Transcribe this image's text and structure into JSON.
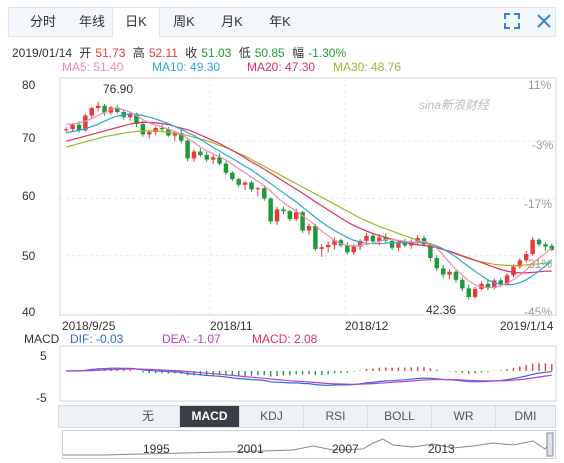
{
  "tabs": [
    "分时",
    "年线",
    "日K",
    "周K",
    "月K",
    "年K"
  ],
  "active_tab": "日K",
  "quote": {
    "date": "2019/01/14",
    "open_label": "开",
    "open": "51.73",
    "high_label": "高",
    "high": "52.11",
    "close_label": "收",
    "close": "51.03",
    "low_label": "低",
    "low": "50.85",
    "change_label": "幅",
    "change": "-1.30%"
  },
  "ma": [
    {
      "label": "MA5: 51.40",
      "color": "#f08ab0"
    },
    {
      "label": "MA10: 49.30",
      "color": "#2aa6d8"
    },
    {
      "label": "MA20: 47.30",
      "color": "#e0305a"
    },
    {
      "label": "MA30: 48.76",
      "color": "#9cb82a"
    }
  ],
  "y_ticks": [
    "80",
    "70",
    "60",
    "50",
    "40"
  ],
  "pct_ticks": [
    "11%",
    "-3%",
    "-17%",
    "-31%",
    "-45%"
  ],
  "x_labels": [
    "2018/9/25",
    "2018/11",
    "2018/12",
    "2019/1/14"
  ],
  "annotations": {
    "high": "76.90",
    "low": "42.36"
  },
  "watermark": "sina新浪财经",
  "macd": {
    "title": "MACD",
    "dif": "DIF: -0.03",
    "dea": "DEA: -1.07",
    "macd": "MACD: 2.08",
    "y_ticks": [
      "5",
      "-5"
    ]
  },
  "indicators": [
    "无",
    "MACD",
    "KDJ",
    "RSI",
    "BOLL",
    "WR",
    "DMI"
  ],
  "active_indicator": "MACD",
  "overview_years": [
    "1995",
    "2001",
    "2007",
    "2013"
  ],
  "colors": {
    "up": "#e63b3b",
    "down": "#1f9a3a",
    "accent": "#2b6fd6"
  },
  "icons": [
    "expand-icon",
    "close-icon",
    "arrow-up-icon",
    "arrow-down-icon"
  ],
  "chart_data": {
    "type": "candlestick",
    "ylim": [
      40,
      80
    ],
    "candles": [
      [
        72.0,
        72.5,
        71.6,
        72.1
      ],
      [
        72.1,
        73.2,
        71.8,
        72.9
      ],
      [
        72.9,
        73.5,
        71.5,
        71.9
      ],
      [
        71.9,
        74.8,
        71.7,
        74.5
      ],
      [
        74.5,
        76.0,
        74.0,
        75.8
      ],
      [
        75.8,
        76.9,
        75.2,
        76.2
      ],
      [
        76.2,
        76.5,
        74.5,
        75.0
      ],
      [
        75.0,
        76.2,
        74.6,
        75.9
      ],
      [
        75.9,
        76.3,
        74.8,
        75.1
      ],
      [
        75.1,
        75.6,
        73.8,
        74.2
      ],
      [
        74.2,
        75.2,
        73.6,
        74.8
      ],
      [
        74.8,
        75.0,
        72.5,
        73.0
      ],
      [
        73.0,
        73.6,
        70.8,
        71.2
      ],
      [
        71.2,
        72.0,
        70.5,
        71.6
      ],
      [
        71.6,
        72.6,
        71.0,
        72.3
      ],
      [
        72.3,
        73.0,
        71.6,
        72.1
      ],
      [
        72.1,
        72.5,
        70.8,
        71.0
      ],
      [
        71.0,
        71.8,
        70.0,
        71.4
      ],
      [
        71.4,
        72.0,
        69.6,
        70.1
      ],
      [
        70.1,
        70.3,
        66.5,
        67.0
      ],
      [
        67.0,
        68.6,
        66.4,
        68.2
      ],
      [
        68.2,
        68.8,
        67.3,
        67.6
      ],
      [
        67.6,
        68.1,
        66.4,
        66.8
      ],
      [
        66.8,
        67.6,
        66.0,
        67.2
      ],
      [
        67.2,
        67.9,
        65.8,
        66.1
      ],
      [
        66.1,
        66.5,
        64.1,
        64.5
      ],
      [
        64.5,
        64.8,
        63.0,
        63.4
      ],
      [
        63.4,
        63.6,
        62.0,
        62.4
      ],
      [
        62.4,
        63.0,
        61.5,
        62.8
      ],
      [
        62.8,
        63.1,
        61.2,
        61.6
      ],
      [
        61.6,
        62.0,
        60.4,
        61.8
      ],
      [
        61.8,
        62.1,
        59.6,
        60.0
      ],
      [
        60.0,
        60.2,
        55.5,
        56.0
      ],
      [
        56.0,
        58.6,
        55.4,
        58.1
      ],
      [
        58.1,
        58.6,
        57.3,
        57.8
      ],
      [
        57.8,
        58.0,
        56.0,
        56.4
      ],
      [
        56.4,
        58.2,
        56.0,
        57.6
      ],
      [
        57.6,
        57.9,
        54.0,
        54.4
      ],
      [
        54.4,
        55.6,
        53.6,
        55.2
      ],
      [
        55.2,
        55.6,
        50.8,
        51.2
      ],
      [
        51.2,
        52.0,
        49.8,
        51.5
      ],
      [
        51.5,
        52.5,
        50.6,
        51.9
      ],
      [
        51.9,
        53.2,
        51.1,
        52.7
      ],
      [
        52.7,
        53.0,
        51.5,
        51.8
      ],
      [
        51.8,
        52.4,
        50.2,
        50.6
      ],
      [
        50.6,
        52.0,
        50.1,
        51.6
      ],
      [
        51.6,
        52.9,
        51.0,
        52.6
      ],
      [
        52.6,
        54.0,
        52.0,
        53.5
      ],
      [
        53.5,
        54.0,
        52.1,
        52.5
      ],
      [
        52.5,
        53.8,
        51.8,
        53.2
      ],
      [
        53.2,
        53.9,
        52.3,
        52.6
      ],
      [
        52.6,
        52.8,
        51.0,
        51.4
      ],
      [
        51.4,
        52.6,
        50.8,
        52.2
      ],
      [
        52.2,
        53.0,
        51.5,
        51.8
      ],
      [
        51.8,
        52.9,
        51.2,
        52.5
      ],
      [
        52.5,
        53.6,
        51.9,
        53.1
      ],
      [
        53.1,
        53.5,
        51.6,
        52.0
      ],
      [
        52.0,
        52.3,
        49.1,
        49.6
      ],
      [
        49.6,
        50.1,
        47.3,
        47.8
      ],
      [
        47.8,
        48.4,
        46.1,
        46.7
      ],
      [
        46.7,
        47.6,
        45.9,
        47.2
      ],
      [
        47.2,
        47.5,
        45.3,
        45.8
      ],
      [
        45.8,
        46.2,
        43.8,
        44.3
      ],
      [
        44.3,
        45.0,
        42.36,
        42.8
      ],
      [
        42.8,
        44.6,
        42.5,
        44.2
      ],
      [
        44.2,
        45.5,
        43.9,
        45.1
      ],
      [
        45.1,
        45.8,
        44.0,
        44.4
      ],
      [
        44.4,
        46.0,
        44.1,
        45.7
      ],
      [
        45.7,
        46.1,
        44.6,
        45.0
      ],
      [
        45.0,
        47.0,
        44.8,
        46.6
      ],
      [
        46.6,
        48.5,
        46.2,
        48.1
      ],
      [
        48.1,
        49.6,
        47.7,
        49.2
      ],
      [
        49.2,
        50.8,
        48.8,
        50.3
      ],
      [
        50.3,
        53.3,
        50.0,
        52.8
      ],
      [
        52.8,
        53.1,
        51.6,
        52.0
      ],
      [
        52.0,
        52.4,
        50.9,
        51.6
      ],
      [
        51.73,
        52.11,
        50.85,
        51.03
      ]
    ],
    "ma5": [
      73,
      73,
      73.2,
      73.5,
      74,
      74.5,
      75,
      75.6,
      75.8,
      75.5,
      75.1,
      74.5,
      73.8,
      73.2,
      72.8,
      72.5,
      72.1,
      71.7,
      71.2,
      70.5,
      69.8,
      69,
      68.3,
      67.8,
      67.3,
      66.7,
      66,
      65.2,
      64.5,
      63.7,
      63,
      62.2,
      61.3,
      60.2,
      59.3,
      58.5,
      57.8,
      57,
      56.2,
      55.3,
      54.3,
      53.5,
      52.6,
      52.1,
      51.8,
      51.7,
      51.8,
      52,
      52.2,
      52.5,
      52.8,
      52.9,
      52.7,
      52.5,
      52.4,
      52.4,
      52.5,
      52.1,
      51.3,
      50.1,
      48.8,
      47.6,
      46.6,
      45.6,
      44.9,
      44.6,
      44.4,
      44.5,
      44.8,
      45.2,
      45.8,
      46.6,
      47.5,
      48.6,
      49.6,
      50.4,
      51.4
    ],
    "ma10": [
      71.5,
      71.7,
      71.9,
      72.2,
      72.6,
      73,
      73.5,
      74,
      74.4,
      74.6,
      74.8,
      74.7,
      74.5,
      74.2,
      73.9,
      73.5,
      73.1,
      72.6,
      72.1,
      71.5,
      71,
      70.3,
      69.6,
      68.9,
      68.3,
      67.6,
      67,
      66.3,
      65.6,
      65,
      64.2,
      63.4,
      62.6,
      61.8,
      61,
      60.2,
      59.4,
      58.5,
      57.6,
      56.7,
      55.9,
      55.1,
      54.4,
      53.8,
      53.2,
      52.7,
      52.4,
      52.2,
      52.1,
      52.1,
      52.2,
      52.3,
      52.3,
      52.3,
      52.3,
      52.3,
      52.3,
      52.1,
      51.7,
      51.2,
      50.5,
      49.8,
      48.9,
      48.1,
      47.3,
      46.5,
      45.8,
      45.3,
      45,
      44.9,
      45,
      45.3,
      45.8,
      46.5,
      47.3,
      48.2,
      49.3
    ],
    "ma20": [
      70,
      70.3,
      70.6,
      70.9,
      71.2,
      71.5,
      71.8,
      72.1,
      72.4,
      72.7,
      73,
      73.2,
      73.3,
      73.3,
      73.2,
      73.1,
      72.9,
      72.6,
      72.3,
      72,
      71.6,
      71.1,
      70.6,
      70.1,
      69.6,
      69,
      68.4,
      67.8,
      67.1,
      66.4,
      65.8,
      65.1,
      64.4,
      63.7,
      63,
      62.3,
      61.6,
      60.9,
      60.2,
      59.4,
      58.7,
      58,
      57.3,
      56.6,
      55.9,
      55.3,
      54.8,
      54.3,
      53.9,
      53.5,
      53.2,
      52.9,
      52.6,
      52.3,
      52.1,
      51.9,
      51.8,
      51.6,
      51.4,
      51.1,
      50.8,
      50.4,
      50,
      49.6,
      49.2,
      48.8,
      48.4,
      48,
      47.6,
      47.3,
      47.1,
      47,
      47,
      47.1,
      47.2,
      47.3,
      47.3
    ],
    "ma30": [
      69,
      69.3,
      69.6,
      69.9,
      70.2,
      70.5,
      70.8,
      71,
      71.2,
      71.4,
      71.6,
      71.7,
      71.8,
      71.8,
      71.8,
      71.7,
      71.6,
      71.4,
      71.2,
      71,
      70.7,
      70.4,
      70.1,
      69.7,
      69.3,
      68.9,
      68.4,
      67.9,
      67.4,
      66.8,
      66.2,
      65.6,
      65,
      64.4,
      63.8,
      63.2,
      62.6,
      62,
      61.4,
      60.8,
      60.2,
      59.6,
      59,
      58.4,
      57.8,
      57.2,
      56.6,
      56.1,
      55.6,
      55.1,
      54.7,
      54.3,
      53.9,
      53.5,
      53.1,
      52.7,
      52.3,
      51.9,
      51.5,
      51.1,
      50.7,
      50.3,
      49.9,
      49.5,
      49.2,
      48.9,
      48.7,
      48.5,
      48.4,
      48.3,
      48.3,
      48.3,
      48.4,
      48.5,
      48.6,
      48.7,
      48.76
    ]
  }
}
